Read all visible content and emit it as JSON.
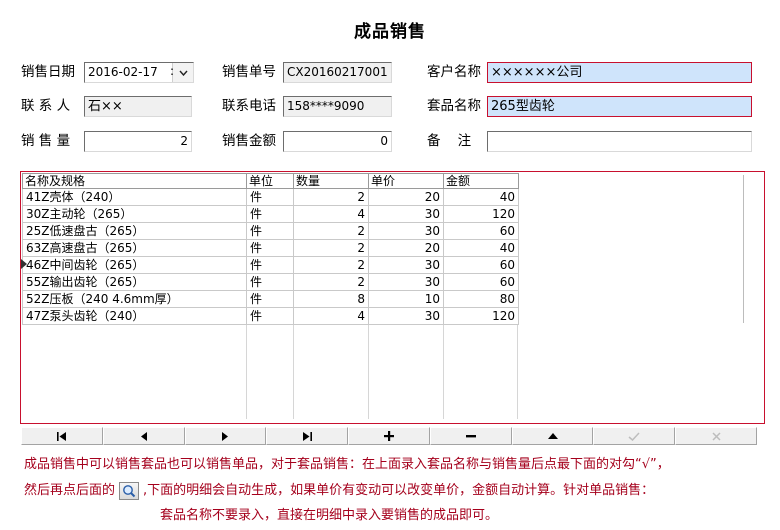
{
  "title": "成品销售",
  "form": {
    "sale_date_label": "销售日期",
    "sale_date_value": "2016-02-17",
    "sale_no_label": "销售单号",
    "sale_no_value": "CX20160217001",
    "customer_label": "客户名称",
    "customer_value": "××××××公司",
    "contact_label": "联 系 人",
    "contact_value": "石××",
    "phone_label": "联系电话",
    "phone_value": "158****9090",
    "set_label": "套品名称",
    "set_value": "265型齿轮",
    "qty_label": "销 售 量",
    "qty_value": "2",
    "amount_label": "销售金额",
    "amount_value": "0",
    "remark_label": "备    注",
    "remark_value": ""
  },
  "grid": {
    "columns": [
      "名称及规格",
      "单位",
      "数量",
      "单价",
      "金额"
    ],
    "rows": [
      [
        "41Z壳体（240）",
        "件",
        "2",
        "20",
        "40"
      ],
      [
        "30Z主动轮（265）",
        "件",
        "4",
        "30",
        "120"
      ],
      [
        "25Z低速盘古（265）",
        "件",
        "2",
        "30",
        "60"
      ],
      [
        "63Z高速盘古（265）",
        "件",
        "2",
        "20",
        "40"
      ],
      [
        "46Z中间齿轮（265）",
        "件",
        "2",
        "30",
        "60"
      ],
      [
        "55Z输出齿轮（265）",
        "件",
        "2",
        "30",
        "60"
      ],
      [
        "52Z压板（240 4.6mm厚）",
        "件",
        "8",
        "10",
        "80"
      ],
      [
        "47Z泵头齿轮（240）",
        "件",
        "4",
        "30",
        "120"
      ]
    ]
  },
  "navigator": [
    "|◀",
    "◀",
    "▶",
    "▶|",
    "+",
    "−",
    "▲",
    "✓",
    "✕"
  ],
  "notes": {
    "line1": "成品销售中可以销售套品也可以销售单品，对于套品销售：在上面录入套品名称与销售量后点最下面的对勾“√”，",
    "line2a": "然后再点后面的",
    "line2b": ",下面的明细会自动生成，如果单价有变动可以改变单价，金额自动计算。针对单品销售：",
    "line3": "套品名称不要录入，直接在明细中录入要销售的成品即可。"
  }
}
